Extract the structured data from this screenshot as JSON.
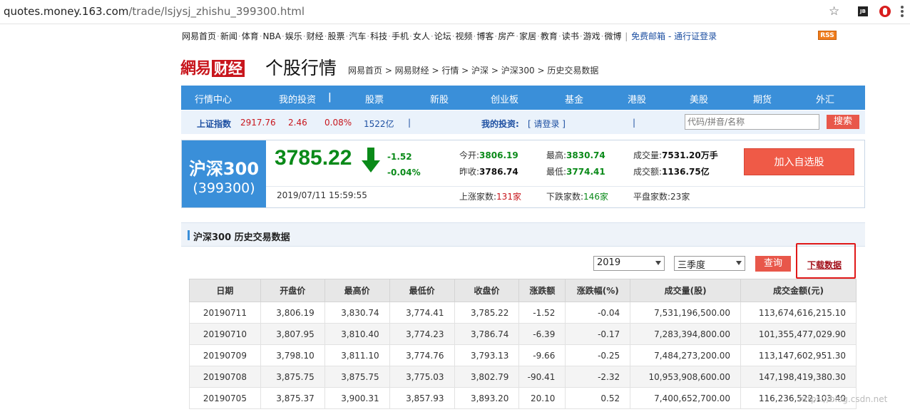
{
  "browser": {
    "url_host": "quotes.money.163.com",
    "url_path": "/trade/lsjysj_zhishu_399300.html"
  },
  "topnav": {
    "items": [
      "网易首页",
      "新闻",
      "体育",
      "NBA",
      "娱乐",
      "财经",
      "股票",
      "汽车",
      "科技",
      "手机",
      "女人",
      "论坛",
      "视频",
      "博客",
      "房产",
      "家居",
      "教育",
      "读书",
      "游戏",
      "微博"
    ],
    "links": [
      "免费邮箱",
      "通行证登录"
    ],
    "rss": "RSS"
  },
  "logo": {
    "brand": "網易",
    "section": "财经"
  },
  "page_title": "个股行情",
  "breadcrumb": "网易首页 > 网易财经 > 行情 > 沪深 > 沪深300 > 历史交易数据",
  "bluenav": [
    "行情中心",
    "我的投资",
    "股票",
    "新股",
    "创业板",
    "基金",
    "港股",
    "美股",
    "期货",
    "外汇"
  ],
  "indexbar": {
    "name": "上证指数",
    "value": "2917.76",
    "change": "2.46",
    "pct": "0.08%",
    "volume": "1522亿",
    "my_invest": "我的投资:",
    "login": "[ 请登录 ]",
    "search_placeholder": "代码/拼音/名称",
    "search_button": "搜索"
  },
  "quote": {
    "name": "沪深300",
    "code": "(399300)",
    "price": "3785.22",
    "change": "-1.52",
    "pct": "-0.04%",
    "time": "2019/07/11 15:59:55",
    "open_label": "今开:",
    "open": "3806.19",
    "prev_label": "昨收:",
    "prev": "3786.74",
    "high_label": "最高:",
    "high": "3830.74",
    "low_label": "最低:",
    "low": "3774.41",
    "vol_label": "成交量:",
    "vol": "7531.20万手",
    "amt_label": "成交额:",
    "amt": "1136.75亿",
    "up_label": "上涨家数:",
    "up": "131家",
    "down_label": "下跌家数:",
    "down": "146家",
    "flat_label": "平盘家数:",
    "flat": "23家",
    "add_button": "加入自选股"
  },
  "section_title": "沪深300 历史交易数据",
  "filters": {
    "year": "2019",
    "season": "三季度",
    "query_button": "查询",
    "download": "下载数据"
  },
  "table": {
    "headers": [
      "日期",
      "开盘价",
      "最高价",
      "最低价",
      "收盘价",
      "涨跌额",
      "涨跌幅(%)",
      "成交量(股)",
      "成交金额(元)"
    ],
    "rows": [
      [
        "20190711",
        "3,806.19",
        "3,830.74",
        "3,774.41",
        "3,785.22",
        "-1.52",
        "-0.04",
        "7,531,196,500.00",
        "113,674,616,215.10"
      ],
      [
        "20190710",
        "3,807.95",
        "3,810.40",
        "3,774.23",
        "3,786.74",
        "-6.39",
        "-0.17",
        "7,283,394,800.00",
        "101,355,477,029.90"
      ],
      [
        "20190709",
        "3,798.10",
        "3,811.10",
        "3,774.76",
        "3,793.13",
        "-9.66",
        "-0.25",
        "7,484,273,200.00",
        "113,147,602,951.30"
      ],
      [
        "20190708",
        "3,875.75",
        "3,875.75",
        "3,775.03",
        "3,802.79",
        "-90.41",
        "-2.32",
        "10,953,908,600.00",
        "147,198,419,380.30"
      ],
      [
        "20190705",
        "3,875.37",
        "3,900.31",
        "3,857.93",
        "3,893.20",
        "20.10",
        "0.52",
        "7,400,652,700.00",
        "116,236,522,103.40"
      ]
    ]
  },
  "watermark": "https://blog.csdn.net"
}
